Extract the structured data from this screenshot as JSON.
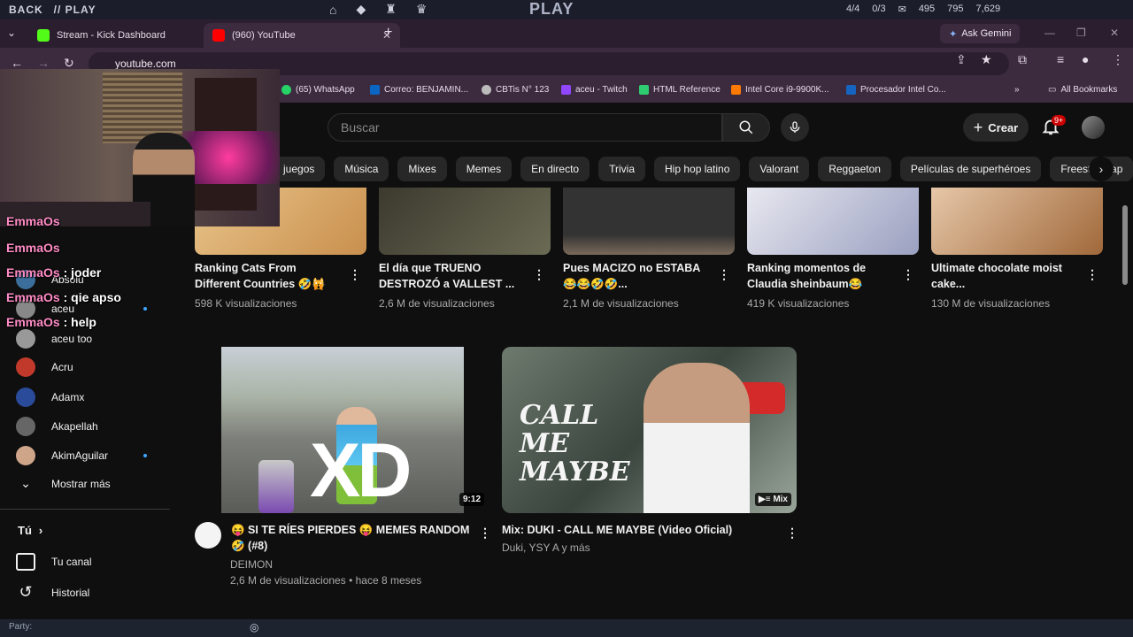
{
  "hud": {
    "back": "BACK",
    "play_left": "// PLAY",
    "title": "PLAY",
    "stat1": "4/4",
    "stat2": "0/3",
    "stat3": "495",
    "stat4": "795",
    "stat5": "7,629"
  },
  "tabs": [
    {
      "label": "Stream - Kick Dashboard",
      "favicon_color": "#53fc18"
    },
    {
      "label": "(960) YouTube",
      "favicon_color": "#ff0000"
    }
  ],
  "ask_gemini": "Ask Gemini",
  "url": "youtube.com",
  "bookmarks": [
    {
      "label": "(65) WhatsApp",
      "color": "#25d366"
    },
    {
      "label": "Correo: BENJAMIN...",
      "color": "#0a66c2"
    },
    {
      "label": "CBTis N° 123",
      "color": "#bbbbbb"
    },
    {
      "label": "aceu - Twitch",
      "color": "#9146ff"
    },
    {
      "label": "HTML Reference",
      "color": "#2ecc71"
    },
    {
      "label": "Intel Core i9-9900K...",
      "color": "#ff7a00"
    },
    {
      "label": "Procesador Intel Co...",
      "color": "#1565c0"
    }
  ],
  "all_bookmarks": "All Bookmarks",
  "header": {
    "search_placeholder": "Buscar",
    "crear": "Crear",
    "notif_count": "9+"
  },
  "chips": [
    "juegos",
    "Música",
    "Mixes",
    "Memes",
    "En directo",
    "Trivia",
    "Hip hop latino",
    "Valorant",
    "Reggaeton",
    "Películas de superhéroes",
    "Freestyle rap"
  ],
  "top_videos": [
    {
      "title_1": "Ranking Cats From",
      "title_2": "Different Countries 🤣🙀",
      "views": "598 K visualizaciones",
      "colors": [
        "#e8c48a",
        "#c98f4d"
      ]
    },
    {
      "title_1": "El día que TRUENO",
      "title_2": "DESTROZÓ a VALLEST ...",
      "views": "2,6 M de visualizaciones",
      "colors": [
        "#3c3a2e",
        "#6b6a54"
      ]
    },
    {
      "title_1": "Pues MACIZO no ESTABA",
      "title_2": "😂😂🤣🤣...",
      "views": "2,1 M de visualizaciones",
      "colors": [
        "#333333",
        "#7a6a5a"
      ]
    },
    {
      "title_1": "Ranking momentos de",
      "title_2": "Claudia sheinbaum😂",
      "views": "419 K visualizaciones",
      "colors": [
        "#e8e8f0",
        "#9aa0c0"
      ]
    },
    {
      "title_1": "Ultimate chocolate moist",
      "title_2": "cake...",
      "views": "130 M de visualizaciones",
      "colors": [
        "#d9b38c",
        "#a0683a"
      ]
    }
  ],
  "videos": [
    {
      "title_1": "😝 SI TE RÍES PIERDES 😝 MEMES RANDOM",
      "title_2": "🤣 (#8)",
      "channel": "DEIMON",
      "meta": "2,6 M de visualizaciones • hace 8 meses",
      "duration": "9:12",
      "overlay": "XD"
    },
    {
      "title_1": "Mix: DUKI - CALL ME MAYBE (Video Oficial)",
      "channel": "Duki, YSY A y más",
      "badge": "Mix",
      "overlay": "CALL ME MAYBE"
    }
  ],
  "sidebar": {
    "subs": [
      {
        "label": "Absolu",
        "color": "#3b6e9a"
      },
      {
        "label": "aceu",
        "color": "#888888"
      },
      {
        "label": "aceu too",
        "color": "#999999"
      },
      {
        "label": "Acru",
        "color": "#c0392b"
      },
      {
        "label": "Adamx",
        "color": "#2a4a9a"
      },
      {
        "label": "Akapellah",
        "color": "#666666"
      },
      {
        "label": "AkimAguilar",
        "color": "#cfa58a"
      }
    ],
    "show_more": "Mostrar más",
    "you": "Tú",
    "your_channel": "Tu canal",
    "history": "Historial"
  },
  "chat": [
    {
      "user": "EmmaOs",
      "msg": ""
    },
    {
      "user": "EmmaOs",
      "msg": ""
    },
    {
      "user": "EmmaOs",
      "msg": " : joder"
    },
    {
      "user": "EmmaOs",
      "msg": " : qie apso"
    },
    {
      "user": "EmmaOs",
      "msg": " : help"
    }
  ],
  "bottom": {
    "party": "Party:"
  }
}
